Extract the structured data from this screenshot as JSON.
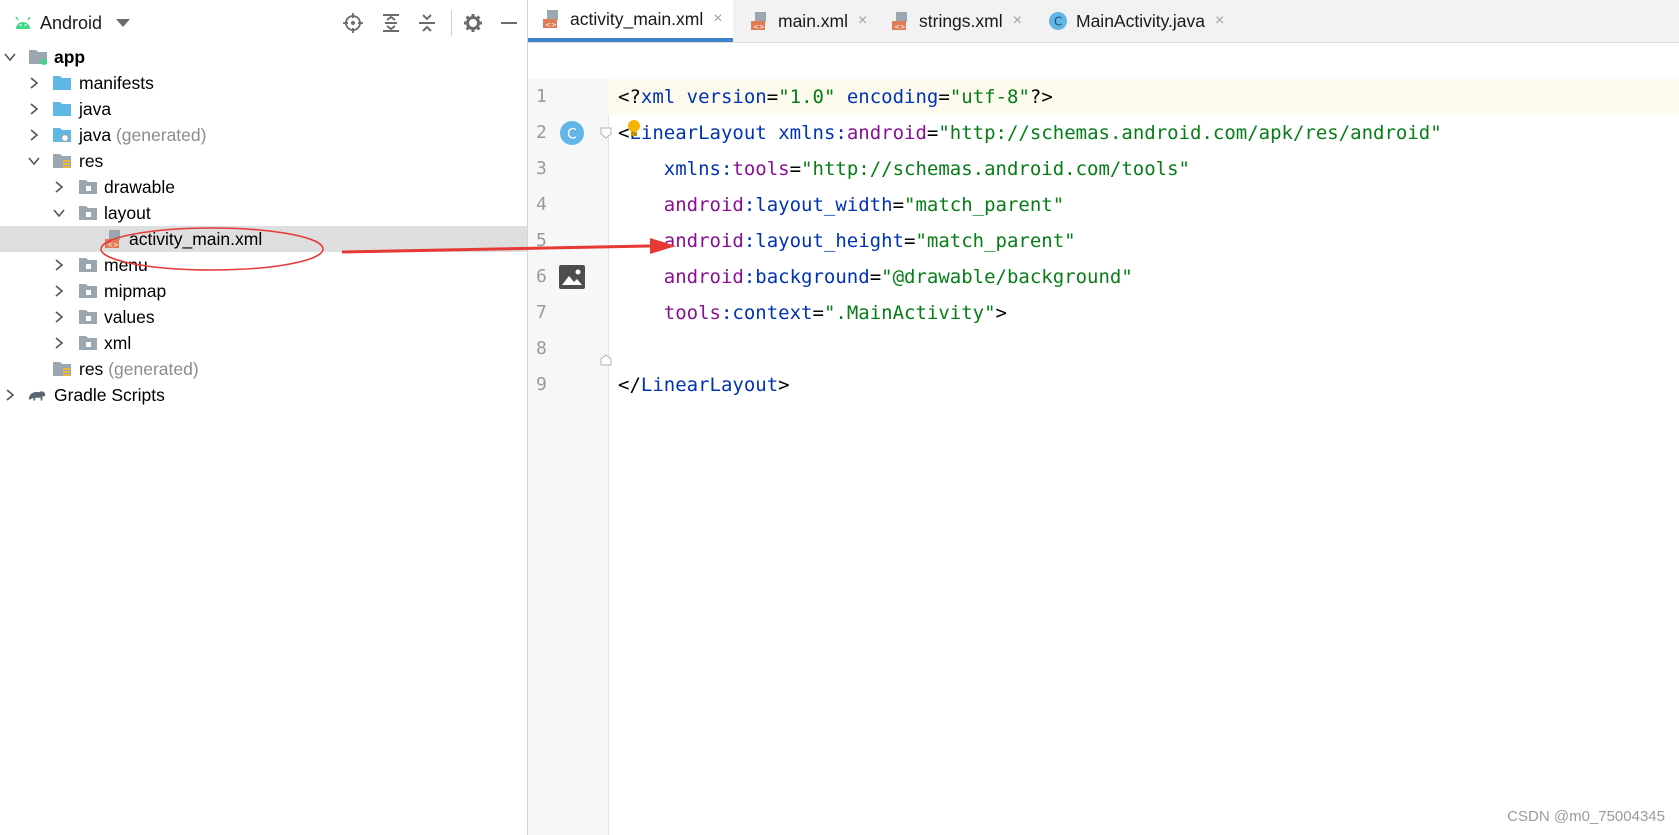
{
  "project_panel": {
    "view_mode": "Android",
    "toolbar_icons": [
      "locate-icon",
      "expand-all-icon",
      "collapse-all-icon",
      "gear-icon",
      "hide-icon"
    ],
    "tree": [
      {
        "label": "app",
        "bold": true,
        "expanded": true,
        "icon": "module-icon"
      },
      {
        "label": "manifests",
        "expanded": false,
        "icon": "folder-icon"
      },
      {
        "label": "java",
        "expanded": false,
        "icon": "folder-icon"
      },
      {
        "label": "java",
        "suffix": "(generated)",
        "expanded": false,
        "icon": "generated-folder-icon"
      },
      {
        "label": "res",
        "expanded": true,
        "icon": "res-folder-icon"
      },
      {
        "label": "drawable",
        "expanded": false,
        "icon": "folder-icon"
      },
      {
        "label": "layout",
        "expanded": true,
        "icon": "folder-icon"
      },
      {
        "label": "activity_main.xml",
        "selected": true,
        "icon": "xml-file-icon"
      },
      {
        "label": "menu",
        "expanded": false,
        "icon": "folder-icon"
      },
      {
        "label": "mipmap",
        "expanded": false,
        "icon": "folder-icon"
      },
      {
        "label": "values",
        "expanded": false,
        "icon": "folder-icon"
      },
      {
        "label": "xml",
        "expanded": false,
        "icon": "folder-icon"
      },
      {
        "label": "res",
        "suffix": "(generated)",
        "icon": "res-folder-icon"
      },
      {
        "label": "Gradle Scripts",
        "expanded": false,
        "icon": "gradle-icon"
      }
    ]
  },
  "editor": {
    "tabs": [
      {
        "label": "activity_main.xml",
        "active": true,
        "icon": "xml-file-icon"
      },
      {
        "label": "main.xml",
        "icon": "xml-file-icon"
      },
      {
        "label": "strings.xml",
        "icon": "xml-file-icon"
      },
      {
        "label": "MainActivity.java",
        "icon": "java-class-icon"
      }
    ],
    "close_glyph": "×",
    "class_badge": "C",
    "line_numbers": [
      "1",
      "2",
      "3",
      "4",
      "5",
      "6",
      "7",
      "8",
      "9"
    ],
    "lines": [
      {
        "line": "1",
        "tokens": [
          [
            "p",
            "<?"
          ],
          [
            "k",
            "xml"
          ],
          [
            "p",
            " "
          ],
          [
            "k",
            "version"
          ],
          [
            "p",
            "="
          ],
          [
            "s",
            "\"1.0\""
          ],
          [
            "p",
            " "
          ],
          [
            "k",
            "encoding"
          ],
          [
            "p",
            "="
          ],
          [
            "s",
            "\"utf-8\""
          ],
          [
            "p",
            "?>"
          ]
        ]
      },
      {
        "line": "2",
        "tokens": [
          [
            "p",
            "<"
          ],
          [
            "k",
            "LinearLayout"
          ],
          [
            "p",
            " "
          ],
          [
            "k",
            "xmlns:"
          ],
          [
            "a",
            "android"
          ],
          [
            "p",
            "="
          ],
          [
            "s",
            "\"http://schemas.android.com/apk/res/android\""
          ]
        ]
      },
      {
        "line": "3",
        "tokens": [
          [
            "p",
            "    "
          ],
          [
            "k",
            "xmlns:"
          ],
          [
            "a",
            "tools"
          ],
          [
            "p",
            "="
          ],
          [
            "s",
            "\"http://schemas.android.com/tools\""
          ]
        ]
      },
      {
        "line": "4",
        "tokens": [
          [
            "p",
            "    "
          ],
          [
            "a",
            "android"
          ],
          [
            "k",
            ":layout_width"
          ],
          [
            "p",
            "="
          ],
          [
            "s",
            "\"match_parent\""
          ]
        ]
      },
      {
        "line": "5",
        "tokens": [
          [
            "p",
            "    "
          ],
          [
            "a",
            "android"
          ],
          [
            "k",
            ":layout_height"
          ],
          [
            "p",
            "="
          ],
          [
            "s",
            "\"match_parent\""
          ]
        ]
      },
      {
        "line": "6",
        "tokens": [
          [
            "p",
            "    "
          ],
          [
            "a",
            "android"
          ],
          [
            "k",
            ":background"
          ],
          [
            "p",
            "="
          ],
          [
            "s",
            "\"@drawable/background\""
          ]
        ]
      },
      {
        "line": "7",
        "tokens": [
          [
            "p",
            "    "
          ],
          [
            "a",
            "tools"
          ],
          [
            "k",
            ":context"
          ],
          [
            "p",
            "="
          ],
          [
            "s",
            "\".MainActivity\""
          ],
          [
            "p",
            ">"
          ]
        ]
      },
      {
        "line": "8",
        "tokens": []
      },
      {
        "line": "9",
        "tokens": [
          [
            "p",
            "</"
          ],
          [
            "k",
            "LinearLayout"
          ],
          [
            "p",
            ">"
          ]
        ]
      }
    ]
  },
  "colors": {
    "keyword": "#0033b3",
    "attribute_ns": "#871094",
    "string": "#067d17",
    "tab_underline": "#4083c9",
    "annotation_red": "#e53935",
    "selection_bg": "#dedede"
  },
  "watermark": "CSDN @m0_75004345"
}
